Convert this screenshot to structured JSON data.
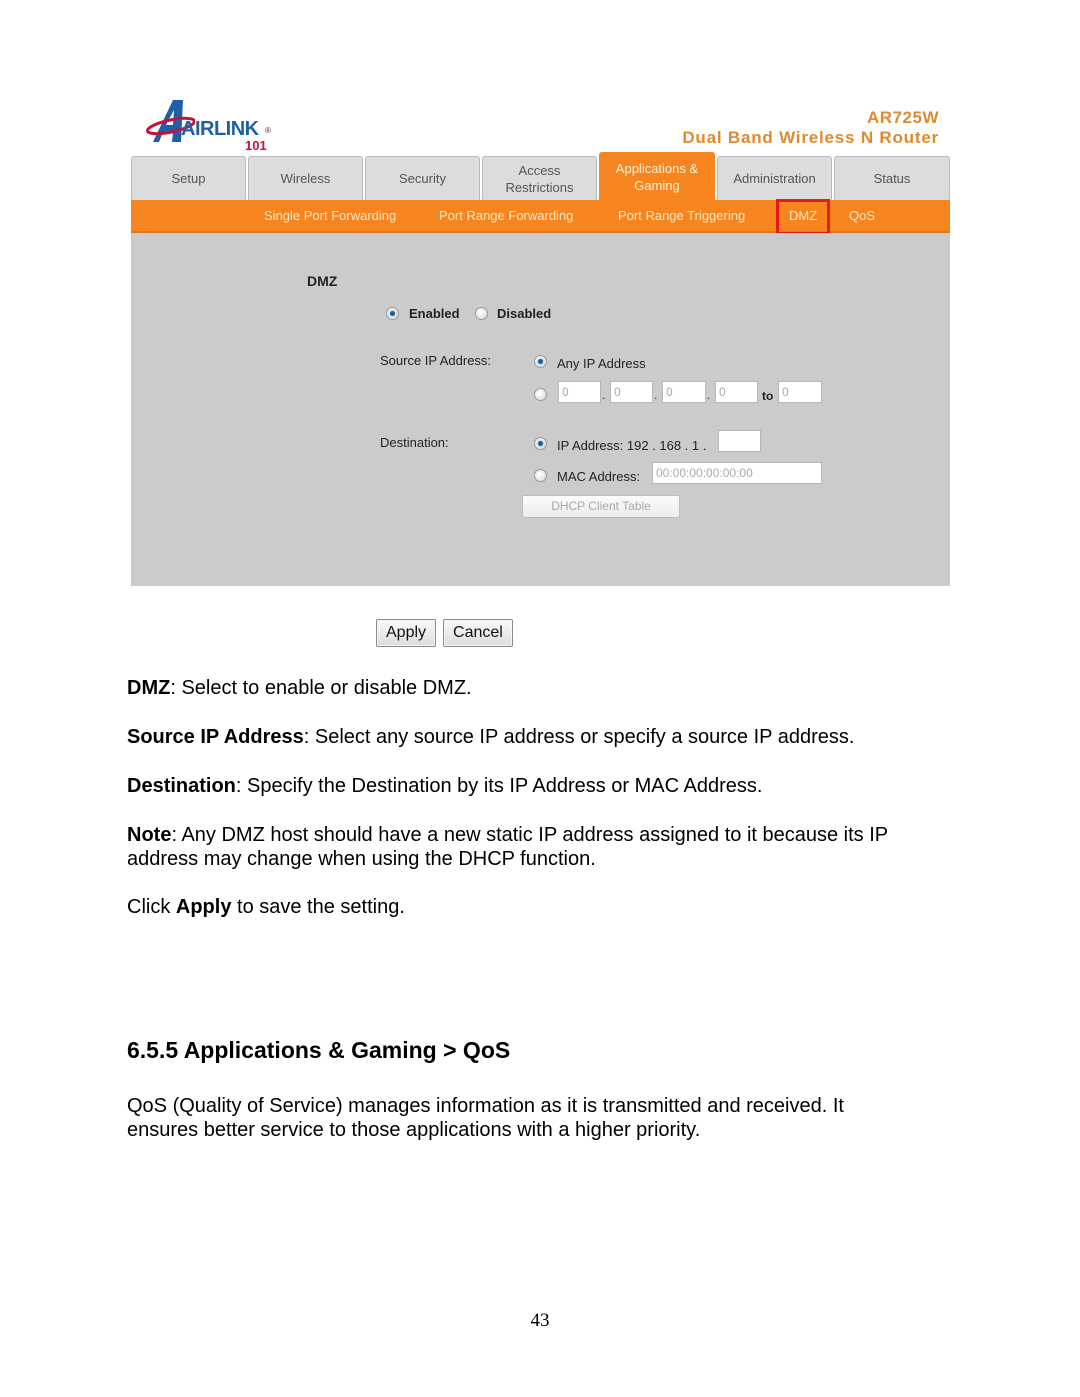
{
  "router_ui": {
    "logo": {
      "brand": "AIRLINK",
      "sub": "101",
      "reg": "®"
    },
    "model": {
      "name": "AR725W",
      "description": "Dual Band Wireless N Router"
    },
    "tabs": [
      {
        "label": "Setup",
        "active": false
      },
      {
        "label": "Wireless",
        "active": false
      },
      {
        "label": "Security",
        "active": false
      },
      {
        "label": "Access\nRestrictions",
        "active": false
      },
      {
        "label": "Applications &\nGaming",
        "active": true
      },
      {
        "label": "Administration",
        "active": false
      },
      {
        "label": "Status",
        "active": false
      }
    ],
    "subnav": [
      {
        "label": "Single Port Forwarding",
        "selected": false
      },
      {
        "label": "Port Range Forwarding",
        "selected": false
      },
      {
        "label": "Port Range Triggering",
        "selected": false
      },
      {
        "label": "DMZ",
        "selected": true
      },
      {
        "label": "QoS",
        "selected": false
      }
    ],
    "section_title": "DMZ",
    "dmz": {
      "enabled_label": "Enabled",
      "disabled_label": "Disabled",
      "selected": "enabled"
    },
    "source_ip": {
      "label": "Source IP Address:",
      "any_label": "Any IP Address",
      "selected": "any",
      "range": {
        "octets": [
          "0",
          "0",
          "0",
          "0"
        ],
        "to_label": "to",
        "to_value": "0"
      }
    },
    "destination": {
      "label": "Destination:",
      "ip_label": "IP Address: 192 . 168 . 1 .",
      "ip_last_octet": "",
      "mac_label": "MAC Address:",
      "mac_value": "00:00:00:00:00:00",
      "selected": "ip",
      "dhcp_button": "DHCP Client Table"
    },
    "buttons": {
      "apply": "Apply",
      "cancel": "Cancel"
    },
    "colors": {
      "accent": "#f7851f",
      "highlight": "#e31b1b",
      "panel": "#cbcbcb",
      "logo_blue": "#1f5fa8",
      "logo_red": "#c4123a",
      "model_text": "#e2892e"
    }
  },
  "document": {
    "paragraphs": [
      {
        "term": "DMZ",
        "text": ": Select to enable or disable DMZ."
      },
      {
        "term": "Source IP Address",
        "text": ": Select any source IP address or specify a source IP address."
      },
      {
        "term": "Destination",
        "text": ": Specify the Destination by its IP Address or MAC Address."
      },
      {
        "term": "Note",
        "text": ": Any DMZ host should have a new static IP address assigned to it because its IP address may change when using the DHCP function."
      }
    ],
    "click_apply": {
      "pre": "Click ",
      "term": "Apply",
      "post": " to save the setting."
    },
    "heading": "6.5.5 Applications & Gaming > QoS",
    "qos_paragraph": "QoS (Quality of Service) manages information as it is transmitted and received. It ensures better service to those applications with a higher priority.",
    "page_number": "43"
  }
}
